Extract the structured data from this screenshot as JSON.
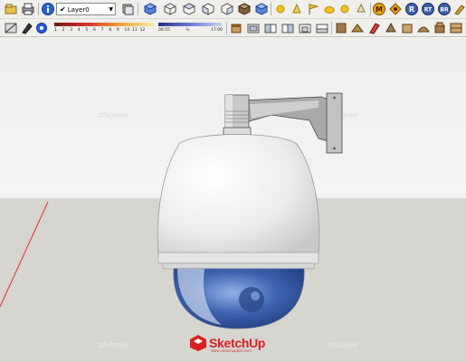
{
  "window": {
    "title": "SketchUp"
  },
  "toolbar": {
    "layer": {
      "current": "Layer0",
      "checked": true
    },
    "shadow_months": [
      "1",
      "2",
      "3",
      "4",
      "5",
      "6",
      "7",
      "8",
      "9",
      "10",
      "11",
      "12"
    ],
    "time_start": "06:55",
    "time_end": "17:00",
    "noon_label": "½"
  },
  "viewport": {
    "axis_color": "#e03030",
    "watermark": "zhimer",
    "logo": {
      "text": "SketchUp",
      "sub": "www.sketchupbar.com",
      "accent": "#d92020"
    },
    "model": "PTZ dome security camera with wall bracket"
  },
  "icons": [
    "open-icon",
    "print-icon",
    "info-icon",
    "layers-icon",
    "3d-cube-icon",
    "iso-view-icon",
    "top-view-icon",
    "front-view-icon",
    "right-view-icon",
    "back-view-icon",
    "left-view-icon",
    "extrude-icon",
    "sandbox-icon",
    "sun-icon",
    "light-icon",
    "flag-icon",
    "material-icon",
    "camera-icon",
    "rotate-icon",
    "render-icon",
    "brush-icon"
  ]
}
